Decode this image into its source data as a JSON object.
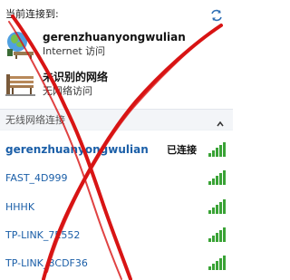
{
  "current": {
    "header": "当前连接到:",
    "refresh_icon": "refresh-icon"
  },
  "networks": [
    {
      "name": "gerenzhuanyongwulian",
      "status": "Internet 访问",
      "icon": "network-computer-icon"
    },
    {
      "name": "未识别的网络",
      "status": "无网络访问",
      "icon": "network-bench-icon"
    }
  ],
  "wireless": {
    "header": "无线网络连接",
    "collapse_icon": "chevron-up-icon",
    "items": [
      {
        "name": "gerenzhuanyongwulian",
        "status": "已连接",
        "signal": 5
      },
      {
        "name": "FAST_4D999",
        "status": "",
        "signal": 5
      },
      {
        "name": "HHHK",
        "status": "",
        "signal": 5
      },
      {
        "name": "TP-LINK_7E552",
        "status": "",
        "signal": 5
      },
      {
        "name": "TP-LINK_8CDF36",
        "status": "",
        "signal": 5
      }
    ]
  },
  "colors": {
    "link_blue": "#1b5fa8",
    "signal_green": "#3aa336",
    "annotation_red": "#d81414"
  }
}
